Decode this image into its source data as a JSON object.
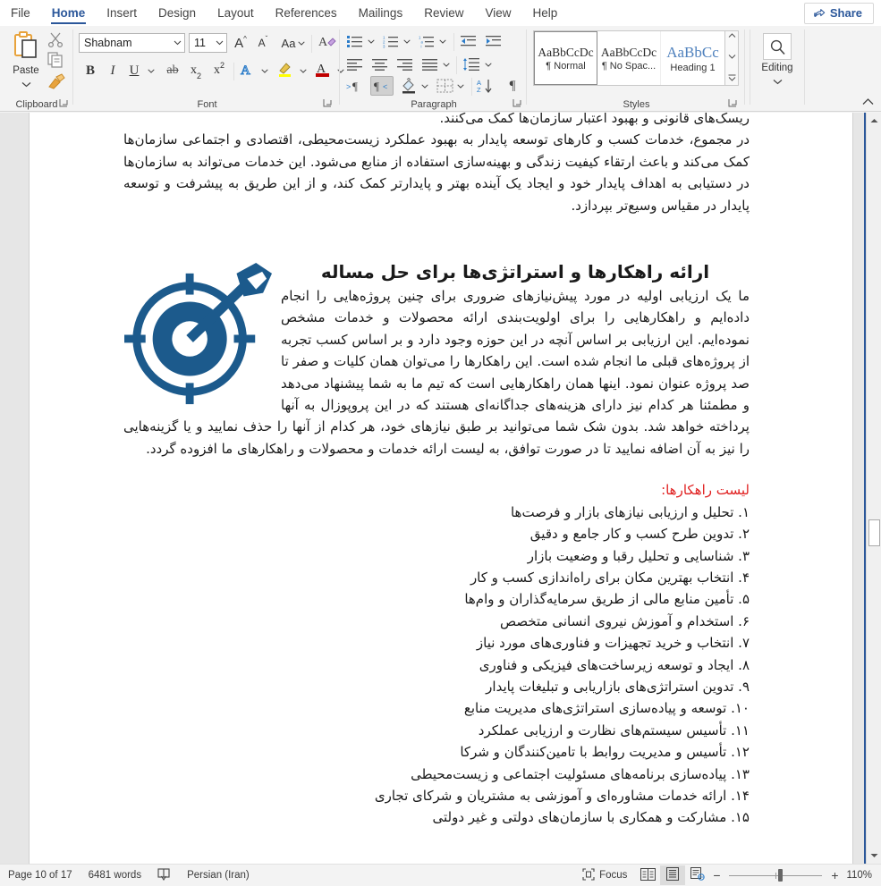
{
  "tabs": [
    {
      "label": "File",
      "active": false
    },
    {
      "label": "Home",
      "active": true
    },
    {
      "label": "Insert",
      "active": false
    },
    {
      "label": "Design",
      "active": false
    },
    {
      "label": "Layout",
      "active": false
    },
    {
      "label": "References",
      "active": false
    },
    {
      "label": "Mailings",
      "active": false
    },
    {
      "label": "Review",
      "active": false
    },
    {
      "label": "View",
      "active": false
    },
    {
      "label": "Help",
      "active": false
    }
  ],
  "share": {
    "label": "Share",
    "icon": "share-icon"
  },
  "ribbon": {
    "clipboard": {
      "group_label": "Clipboard",
      "paste_label": "Paste",
      "cut_icon": "scissors-icon",
      "copy_icon": "copy-icon",
      "format_painter_icon": "format-painter-icon"
    },
    "font": {
      "group_label": "Font",
      "font_name": "Shabnam",
      "font_size": "11",
      "grow_font": "A",
      "shrink_font": "A",
      "change_case": "Aa",
      "clear_formatting_icon": "clear-formatting-icon",
      "bold": "B",
      "italic": "I",
      "underline": "U",
      "strikethrough": "ab",
      "subscript": "x",
      "superscript": "x",
      "text_effects_icon": "text-effects-icon",
      "highlight_icon": "highlight-icon",
      "font_color_icon": "font-color-icon",
      "font_color_hex": "#c00000",
      "highlight_color_hex": "#ffff00"
    },
    "paragraph": {
      "group_label": "Paragraph",
      "bullets_icon": "bullet-list-icon",
      "numbering_icon": "numbered-list-icon",
      "multilevel_icon": "multilevel-list-icon",
      "decrease_indent_icon": "decrease-indent-icon",
      "increase_indent_icon": "increase-indent-icon",
      "align_left_icon": "align-left-icon",
      "align_center_icon": "align-center-icon",
      "align_right_icon": "align-right-icon",
      "justify_icon": "justify-icon",
      "line_spacing_icon": "line-spacing-icon",
      "ltr_icon": "left-to-right-icon",
      "rtl_icon": "right-to-left-icon",
      "rtl_active": true,
      "shading_icon": "shading-icon",
      "borders_icon": "borders-icon",
      "sort_icon": "sort-icon",
      "show_marks_icon": "show-formatting-marks-icon"
    },
    "styles": {
      "group_label": "Styles",
      "items": [
        {
          "preview": "AaBbCcDc",
          "name": "¶ Normal",
          "selected": true
        },
        {
          "preview": "AaBbCcDc",
          "name": "¶ No Spac...",
          "selected": false
        },
        {
          "preview": "AaBbCс",
          "name": "Heading 1",
          "selected": false
        }
      ]
    },
    "editing": {
      "group_label": "",
      "label": "Editing",
      "icon": "search-icon"
    },
    "collapse_icon": "chevron-up-icon"
  },
  "document": {
    "top_paragraphs": [
      "ریسک‌های قانونی و بهبود اعتبار سازمان‌ها کمک می‌کنند.",
      "در مجموع، خدمات کسب و کارهای توسعه پایدار به بهبود عملکرد زیست‌محیطی، اقتصادی و اجتماعی سازمان‌ها کمک می‌کند و باعث ارتقاء کیفیت زندگی و بهینه‌سازی استفاده از منابع می‌شود. این خدمات می‌تواند به سازمان‌ها در دستیابی به اهداف پایدار خود و ایجاد یک آینده بهتر و پایدارتر کمک کند، و از این طریق به پیشرفت و توسعه پایدار در مقیاس وسیع‌تر بپردازد."
    ],
    "heading": "ارائه راهکارها و استراتژی‌ها برای حل مساله",
    "icon_name": "target-dartboard-icon",
    "icon_color": "#1c5a8c",
    "body_paragraph": "ما یک ارزیابی اولیه در مورد پیش‌نیازهای ضروری برای چنین پروژه‌هایی را انجام داده‌ایم و راهکارهایی را برای اولویت‌بندی ارائه محصولات و خدمات مشخص نموده‌ایم. این ارزیابی بر اساس آنچه در این حوزه وجود دارد و بر اساس کسب تجربه از پروژه‌های قبلی ما انجام شده است. این راهکارها را می‌توان همان کلیات و صفر تا صد پروژه عنوان نمود. اینها همان راهکارهایی است که تیم ما به شما پیشنهاد می‌دهد و مطمئنا هر کدام نیز دارای هزینه‌های جداگانه‌ای هستند که در این پروپوزال به آنها پرداخته خواهد شد. بدون شک شما می‌توانید بر طبق نیازهای خود، هر کدام از آنها را حذف نمایید و یا گزینه‌هایی را نیز به آن اضافه نمایید تا در صورت توافق، به لیست ارائه خدمات و محصولات و راهکارهای ما افزوده گردد.",
    "list_heading": "لیست راهکارها:",
    "list_heading_color": "#e02020",
    "list_items": [
      "۱. تحلیل و ارزیابی نیازهای بازار و فرصت‌ها",
      "۲. تدوین طرح کسب و کار جامع و دقیق",
      "۳. شناسایی و تحلیل رقبا و وضعیت بازار",
      "۴. انتخاب بهترین مکان برای راه‌اندازی کسب و کار",
      "۵. تأمین منابع مالی از طریق سرمایه‌گذاران و وام‌ها",
      "۶. استخدام و آموزش نیروی انسانی متخصص",
      "۷. انتخاب و خرید تجهیزات و فناوری‌های مورد نیاز",
      "۸. ایجاد و توسعه زیرساخت‌های فیزیکی و فناوری",
      "۹. تدوین استراتژی‌های بازاریابی و تبلیغات پایدار",
      "۱۰. توسعه و پیاده‌سازی استراتژی‌های مدیریت منابع",
      "۱۱. تأسیس سیستم‌های نظارت و ارزیابی عملکرد",
      "۱۲. تأسیس و مدیریت روابط با تامین‌کنندگان و شرکا",
      "۱۳. پیاده‌سازی برنامه‌های مسئولیت اجتماعی و زیست‌محیطی",
      "۱۴. ارائه خدمات مشاوره‌ای و آموزشی به مشتریان و شرکای تجاری",
      "۱۵. مشارکت و همکاری با سازمان‌های دولتی و غیر دولتی"
    ]
  },
  "statusbar": {
    "page": "Page 10 of 17",
    "words": "6481 words",
    "proofing_icon": "proofing-errors-icon",
    "language": "Persian (Iran)",
    "focus": "Focus",
    "focus_icon": "focus-icon",
    "read_mode_icon": "read-mode-icon",
    "print_layout_icon": "print-layout-icon",
    "web_layout_icon": "web-layout-icon",
    "zoom_out": "−",
    "zoom_in": "+",
    "zoom_level": "110%"
  }
}
